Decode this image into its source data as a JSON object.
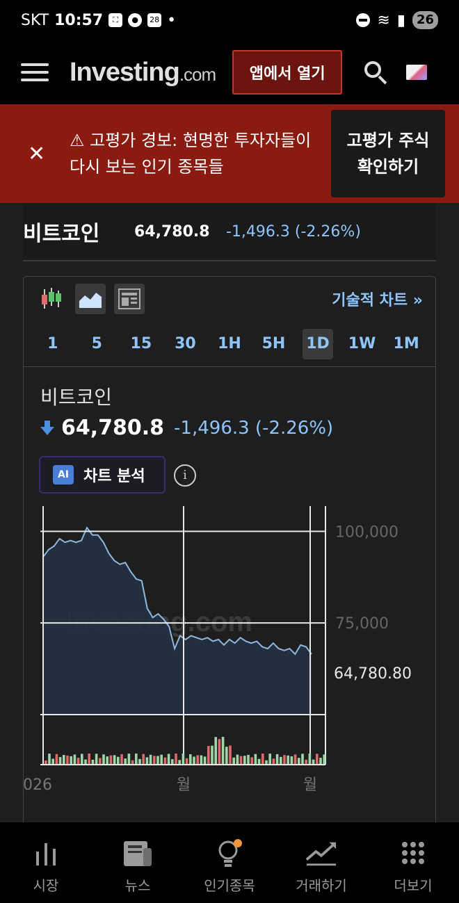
{
  "status_bar": {
    "carrier": "SKT",
    "time": "10:57",
    "calendar_day": "28",
    "battery": "26"
  },
  "header": {
    "logo_main": "Investing",
    "logo_suffix": ".com",
    "open_app_label": "앱에서 열기"
  },
  "alert": {
    "message": "⚠ 고평가 경보: 현명한 투자자들이 다시 보는 인기 종목들",
    "button_label": "고평가 주식 확인하기"
  },
  "quote": {
    "name": "비트코인",
    "price": "64,780.8",
    "change": "-1,496.3  (-2.26%)"
  },
  "chart_toolbar": {
    "technical_chart_label": "기술적 차트 »"
  },
  "timeframes": [
    "1",
    "5",
    "15",
    "30",
    "1H",
    "5H",
    "1D",
    "1W",
    "1M"
  ],
  "selected_timeframe": "1D",
  "chart_header": {
    "title": "비트코인",
    "price": "64,780.8",
    "change": "-1,496.3  (-2.26%)",
    "ai_badge": "AI",
    "ai_label": "차트 분석"
  },
  "colors": {
    "accent": "#8ec5ff",
    "alert_bg": "#8b1a10",
    "line": "#8fb8e0",
    "up_volume": "#9fd6a8",
    "down_volume": "#e06a6a"
  },
  "chart_data": {
    "type": "area",
    "x_labels": [
      "026",
      "월",
      "월"
    ],
    "y_ticks": [
      "100,000",
      "75,000"
    ],
    "last_price_label": "64,780.80",
    "watermark": "Investing.com",
    "ylim": [
      50000,
      105000
    ],
    "values": [
      93000,
      95000,
      96000,
      98000,
      97000,
      97500,
      97000,
      97500,
      101000,
      99000,
      99000,
      97000,
      94000,
      92000,
      91000,
      91500,
      89000,
      87000,
      86500,
      79000,
      76500,
      77500,
      76000,
      74000,
      68000,
      71500,
      70500,
      71500,
      71000,
      70500,
      71000,
      70000,
      70500,
      69000,
      70500,
      69500,
      71000,
      70000,
      69500,
      70000,
      68500,
      68000,
      69500,
      68000,
      67500,
      68000,
      66500,
      69000,
      68500,
      66500
    ]
  },
  "bottom_nav": [
    {
      "label": "시장",
      "icon": "bar-chart-icon"
    },
    {
      "label": "뉴스",
      "icon": "newspaper-icon"
    },
    {
      "label": "인기종목",
      "icon": "lightbulb-icon"
    },
    {
      "label": "거래하기",
      "icon": "trend-up-icon"
    },
    {
      "label": "더보기",
      "icon": "grid-dots-icon"
    }
  ]
}
